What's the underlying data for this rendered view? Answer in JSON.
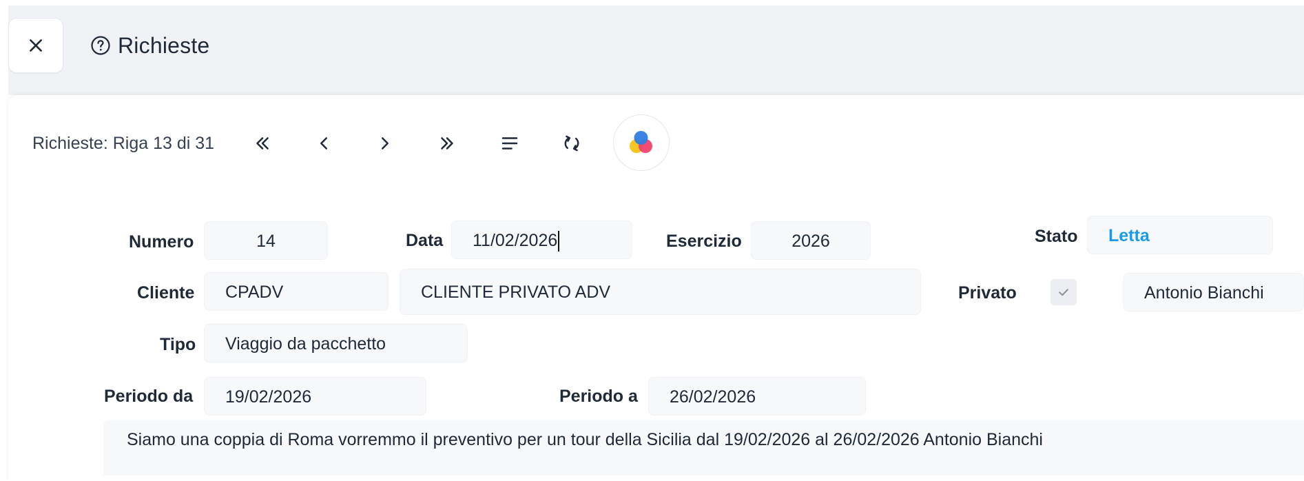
{
  "header": {
    "title": "Richieste",
    "close_icon": "close-icon",
    "help_icon": "help-circle-icon"
  },
  "toolbar": {
    "record_label": "Richieste: Riga 13 di 31",
    "icons": [
      "first-record-icon",
      "previous-record-icon",
      "next-record-icon",
      "last-record-icon",
      "list-icon",
      "refresh-icon",
      "theme-color-icon"
    ]
  },
  "form": {
    "numero": {
      "label": "Numero",
      "value": "14"
    },
    "data": {
      "label": "Data",
      "value": "11/02/2026"
    },
    "esercizio": {
      "label": "Esercizio",
      "value": "2026"
    },
    "stato": {
      "label": "Stato",
      "value": "Letta"
    },
    "cliente": {
      "label": "Cliente",
      "code": "CPADV",
      "name": "CLIENTE PRIVATO ADV"
    },
    "privato": {
      "label": "Privato",
      "checked": true,
      "contact": "Antonio Bianchi"
    },
    "tipo": {
      "label": "Tipo",
      "value": "Viaggio da pacchetto"
    },
    "periodo_da": {
      "label": "Periodo da",
      "value": "19/02/2026"
    },
    "periodo_a": {
      "label": "Periodo a",
      "value": "26/02/2026"
    },
    "note": "Siamo una coppia di Roma vorremmo il preventivo per un tour della Sicilia dal 19/02/2026 al 26/02/2026 Antonio Bianchi"
  },
  "colors": {
    "accent": "#1a9be6",
    "header_bg": "#f1f2f6",
    "field_bg": "#f7f8fa"
  }
}
